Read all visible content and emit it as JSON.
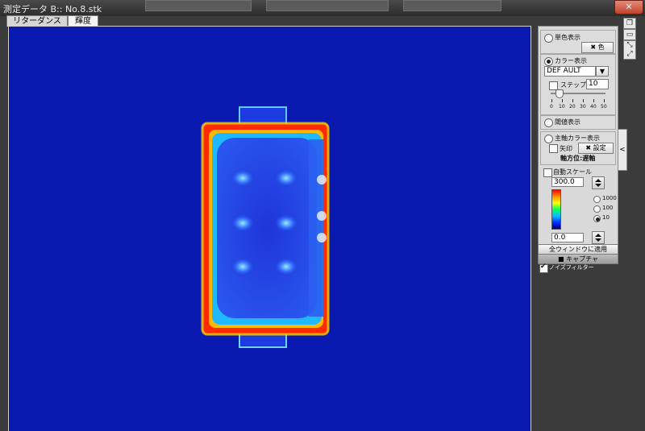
{
  "window": {
    "title": "測定データ B::  No.8.stk",
    "close_label": "✕"
  },
  "tabs": [
    {
      "label": "リターダンス"
    },
    {
      "label": "輝度"
    }
  ],
  "panel": {
    "mono": {
      "label": "単色表示",
      "color_button": "色"
    },
    "color_display": {
      "label": "カラー表示",
      "palette_value": "DEF AULT",
      "step_label": "ステップ",
      "step_value": "10",
      "slider_ticks": [
        "0",
        "10",
        "20",
        "30",
        "40",
        "50"
      ]
    },
    "threshold": {
      "label": "閾値表示"
    },
    "axis": {
      "label": "主軸カラー表示",
      "arrow_label": "矢印",
      "settings_button": "設定",
      "orientation_text": "軸方位:遅軸"
    },
    "auto_scale": {
      "label": "自動スケール",
      "max_value": "300.0",
      "min_value": "0.0",
      "scale_options": [
        "1000",
        "100",
        "10"
      ],
      "selected_scale": "10"
    }
  },
  "actions": {
    "apply_all": "全ウィンドウに適用",
    "capture": "キャプチャ",
    "noise_filter": "ノイズフィルター"
  },
  "icons": {
    "hammer": "hammer-icon",
    "camera": "camera-icon",
    "dropdown": "dropdown-arrow-icon",
    "collapse": "chevron-left-icon"
  },
  "colors": {
    "background_field": "#0a1ab0",
    "hot": "#ff2a00",
    "warm": "#ffd000",
    "cool": "#2a8cff"
  }
}
